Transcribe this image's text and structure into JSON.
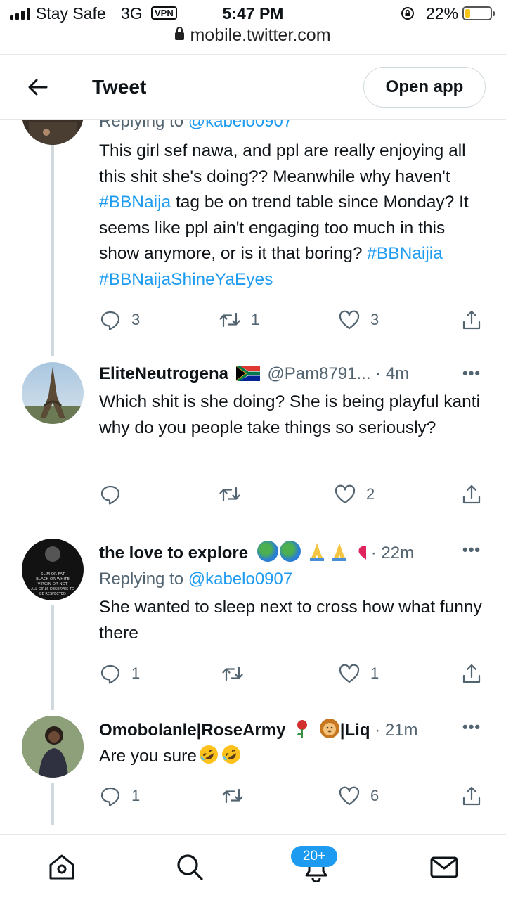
{
  "status_bar": {
    "carrier": "Stay Safe",
    "network": "3G",
    "vpn": "VPN",
    "time": "5:47 PM",
    "battery_percent": "22%",
    "battery_level": 0.22,
    "battery_color": "#f5c518"
  },
  "url_bar": {
    "url": "mobile.twitter.com"
  },
  "header": {
    "title": "Tweet",
    "open_app_label": "Open app"
  },
  "tweets": [
    {
      "reply_to_prefix": "Replying to ",
      "reply_to_handle": "@kabelo0907",
      "text_1": "This girl sef nawa, and ppl are really enjoying all this shit she's doing?? Meanwhile why haven't ",
      "tag_1": "#BBNaija",
      "text_2": " tag be on trend table since Monday? It seems like ppl ain't engaging too much in this show anymore, or is it that boring? ",
      "tag_2": "#BBNaijia",
      "tag_3": "#BBNaijaShineYaEyes",
      "replies": "3",
      "retweets": "1",
      "likes": "3"
    },
    {
      "name": "EliteNeutrogena",
      "flag_icon": "south-africa-flag-icon",
      "handle": "@Pam8791...",
      "time": "· 4m",
      "text": "Which shit is she doing? She is being playful kanti why do you people take things so seriously?",
      "replies": "",
      "retweets": "",
      "likes": "2"
    },
    {
      "name": "the love to explore",
      "emoji_icons": [
        "globe-icon",
        "globe-icon",
        "praying-hands-icon",
        "praying-hands-icon",
        "heart-icon"
      ],
      "time": "· 22m",
      "reply_to_prefix": "Replying to ",
      "reply_to_handle": "@kabelo0907",
      "avatar_text": "SLIM OR FAT BLACK OR WHITE VIRGIN OR NOT ALL GIRLS DESERVES TO BE RESPECTED",
      "text": "She wanted to sleep next to cross how what funny there",
      "replies": "1",
      "retweets": "",
      "likes": "1"
    },
    {
      "name": "Omobolanle|RoseArmy",
      "emoji_icons": [
        "rose-icon",
        "lion-icon"
      ],
      "name_suffix": "|Liq",
      "time": "· 21m",
      "text": "Are you sure",
      "text_emoji_icons": [
        "rofl-emoji-icon",
        "rofl-emoji-icon"
      ],
      "replies": "1",
      "retweets": "",
      "likes": "6"
    }
  ],
  "bottom_nav": {
    "items": [
      "home-icon",
      "search-icon",
      "notifications-icon",
      "messages-icon"
    ],
    "notification_badge": "20+"
  },
  "colors": {
    "link": "#1d9bf0",
    "text": "#0f1419",
    "muted": "#536471",
    "thread_line": "#cfd9de"
  }
}
